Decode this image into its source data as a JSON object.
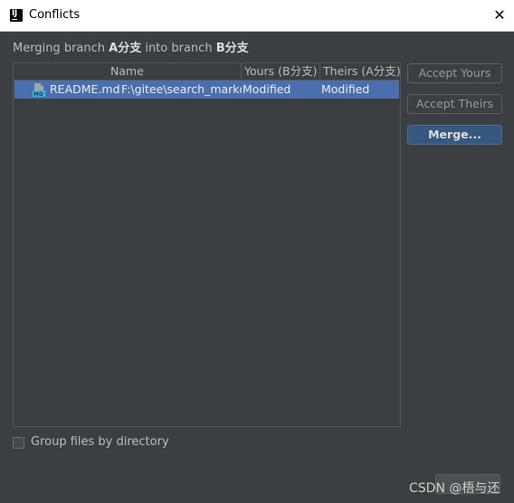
{
  "window": {
    "title": "Conflicts",
    "close_glyph": "✕"
  },
  "header": {
    "prefix": "Merging branch ",
    "source_branch": "A分支",
    "middle": " into branch ",
    "target_branch": "B分支"
  },
  "table": {
    "columns": {
      "name": "Name",
      "yours": "Yours (B分支)",
      "theirs": "Theirs (A分支)"
    },
    "rows": [
      {
        "icon": "markdown-file-icon",
        "file": "README.md",
        "path": "F:\\gitee\\search_markdown",
        "yours": "Modified",
        "theirs": "Modified",
        "selected": true
      }
    ]
  },
  "buttons": {
    "accept_yours": "Accept Yours",
    "accept_theirs": "Accept Theirs",
    "merge": "Merge..."
  },
  "options": {
    "group_by_directory": "Group files by directory",
    "group_by_directory_checked": false
  },
  "watermark": "CSDN @梧与还",
  "colors": {
    "background": "#3c3f41",
    "selection": "#4b6eaf",
    "default_button": "#365880"
  }
}
